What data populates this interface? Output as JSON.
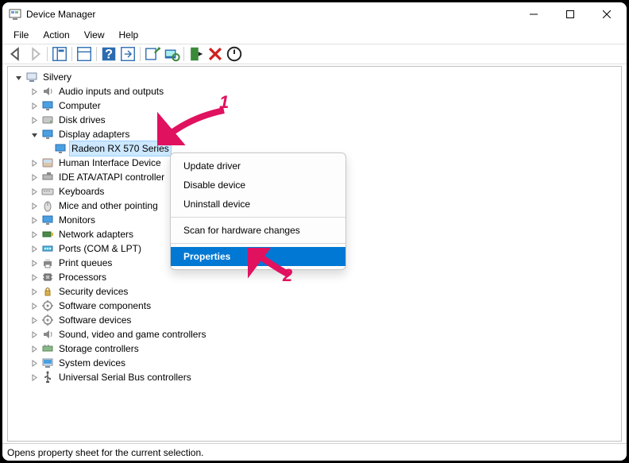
{
  "window": {
    "title": "Device Manager"
  },
  "menu": {
    "items": [
      "File",
      "Action",
      "View",
      "Help"
    ]
  },
  "tree": {
    "root": "Silvery",
    "categories": [
      {
        "label": "Audio inputs and outputs",
        "expanded": false,
        "icon": "speaker"
      },
      {
        "label": "Computer",
        "expanded": false,
        "icon": "monitor"
      },
      {
        "label": "Disk drives",
        "expanded": false,
        "icon": "disk"
      },
      {
        "label": "Display adapters",
        "expanded": true,
        "icon": "monitor",
        "children": [
          {
            "label": "Radeon RX 570 Series",
            "icon": "monitor",
            "selected": true
          }
        ]
      },
      {
        "label": "Human Interface Device",
        "expanded": false,
        "icon": "hid",
        "truncated": true
      },
      {
        "label": "IDE ATA/ATAPI controller",
        "expanded": false,
        "icon": "ide",
        "truncated": true
      },
      {
        "label": "Keyboards",
        "expanded": false,
        "icon": "keyboard"
      },
      {
        "label": "Mice and other pointing",
        "expanded": false,
        "icon": "mouse",
        "truncated": true
      },
      {
        "label": "Monitors",
        "expanded": false,
        "icon": "monitor"
      },
      {
        "label": "Network adapters",
        "expanded": false,
        "icon": "network"
      },
      {
        "label": "Ports (COM & LPT)",
        "expanded": false,
        "icon": "port"
      },
      {
        "label": "Print queues",
        "expanded": false,
        "icon": "printer"
      },
      {
        "label": "Processors",
        "expanded": false,
        "icon": "cpu"
      },
      {
        "label": "Security devices",
        "expanded": false,
        "icon": "security"
      },
      {
        "label": "Software components",
        "expanded": false,
        "icon": "software"
      },
      {
        "label": "Software devices",
        "expanded": false,
        "icon": "software"
      },
      {
        "label": "Sound, video and game controllers",
        "expanded": false,
        "icon": "speaker"
      },
      {
        "label": "Storage controllers",
        "expanded": false,
        "icon": "storage"
      },
      {
        "label": "System devices",
        "expanded": false,
        "icon": "system"
      },
      {
        "label": "Universal Serial Bus controllers",
        "expanded": false,
        "icon": "usb"
      }
    ]
  },
  "context_menu": {
    "items": [
      {
        "label": "Update driver",
        "type": "item"
      },
      {
        "label": "Disable device",
        "type": "item"
      },
      {
        "label": "Uninstall device",
        "type": "item"
      },
      {
        "type": "sep"
      },
      {
        "label": "Scan for hardware changes",
        "type": "item"
      },
      {
        "type": "sep"
      },
      {
        "label": "Properties",
        "type": "item",
        "highlight": true
      }
    ]
  },
  "statusbar": {
    "text": "Opens property sheet for the current selection."
  },
  "annotations": {
    "one": "1",
    "two": "2"
  }
}
